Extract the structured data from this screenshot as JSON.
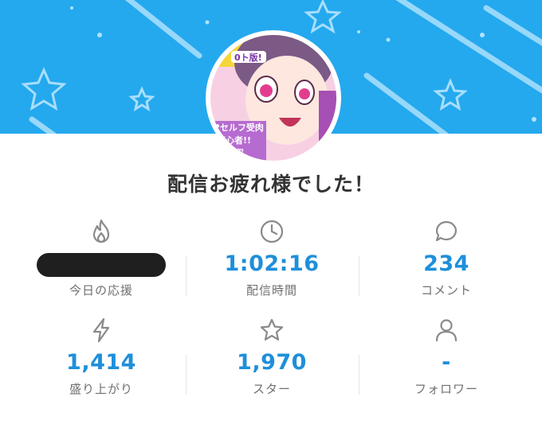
{
  "colors": {
    "banner": "#24a9ee",
    "accent_value": "#1e8fdb",
    "label": "#6f6f6f",
    "icon": "#8a8a8a"
  },
  "headline": "配信お疲れ様でした！",
  "avatar_text": {
    "line1": "0ト版!",
    "line2": "♥セルフ受肉",
    "line3": "初心者!!",
    "line4": "回収"
  },
  "stats": [
    {
      "icon": "fire-icon",
      "value": "",
      "redacted": true,
      "label": "今日の応援"
    },
    {
      "icon": "clock-icon",
      "value": "1:02:16",
      "label": "配信時間"
    },
    {
      "icon": "comment-bubble-icon",
      "value": "234",
      "label": "コメント"
    },
    {
      "icon": "lightning-icon",
      "value": "1,414",
      "label": "盛り上がり"
    },
    {
      "icon": "star-icon",
      "value": "1,970",
      "label": "スター"
    },
    {
      "icon": "person-icon",
      "value": "-",
      "label": "フォロワー"
    }
  ]
}
